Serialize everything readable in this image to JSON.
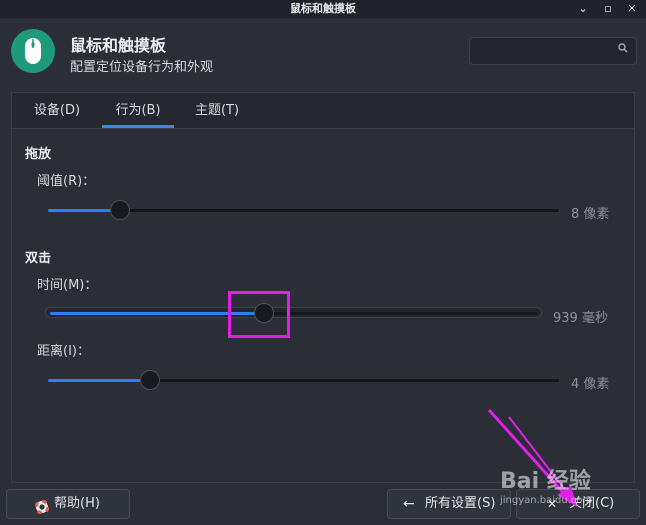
{
  "window": {
    "title": "鼠标和触摸板",
    "minimize_icon": "minimize-icon",
    "maximize_icon": "maximize-icon",
    "close_icon": "close-icon"
  },
  "header": {
    "title": "鼠标和触摸板",
    "subtitle": "配置定位设备行为和外观",
    "search_placeholder": ""
  },
  "tabs": [
    {
      "label": "设备(D)",
      "active": false
    },
    {
      "label": "行为(B)",
      "active": true
    },
    {
      "label": "主题(T)",
      "active": false
    }
  ],
  "drag": {
    "heading": "拖放",
    "threshold_label": "阈值(R)：",
    "threshold_value": "8 像素",
    "threshold_level": 0.14
  },
  "double_click": {
    "heading": "双击",
    "time_label": "时间(M)：",
    "time_value": "939 毫秒",
    "time_level": 0.44,
    "distance_label": "距离(I)：",
    "distance_value": "4 像素",
    "distance_level": 0.2
  },
  "footer": {
    "help_label": "帮助(H)",
    "all_settings_label": "所有设置(S)",
    "close_label": "关闭(C)"
  },
  "watermark": {
    "line1": "Bai 经验",
    "line2": "jingyan.baidu.com"
  },
  "colors": {
    "accent": "#2f7ff0",
    "annotation": "#e020e8",
    "app_icon": "#1d9a7a"
  }
}
